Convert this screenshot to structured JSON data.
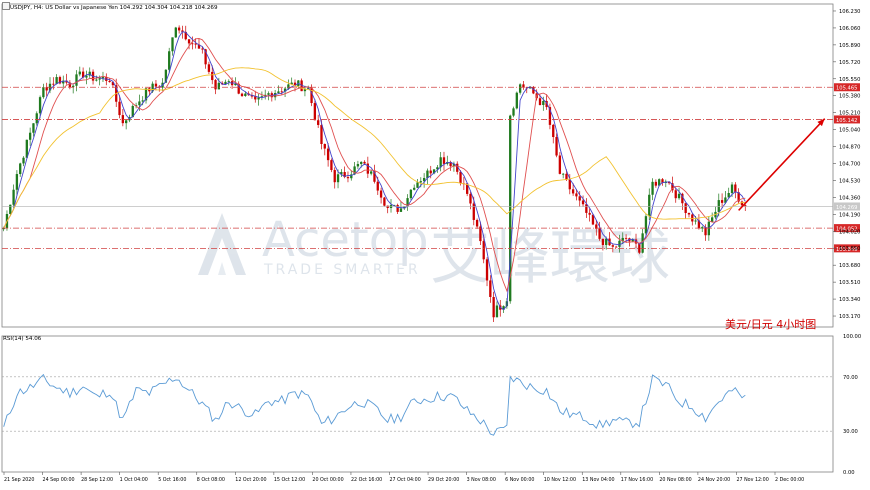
{
  "header": {
    "symbol_line": "USDJPY, H4: US Dollar vs Japanese Yen  104.292 104.304 104.218 104.269",
    "chart_caption": "美元/日元  4小时图",
    "rsi_label": "RSI(14) 54.06"
  },
  "watermark": {
    "brand": "Acetop",
    "tagline": "TRADE SMARTER",
    "chinese": "艾峰環球"
  },
  "colors": {
    "bull": "#1f7a1f",
    "bear": "#cc0000",
    "ma_fast": "#4444cc",
    "ma_mid": "#e05050",
    "ma_slow": "#f2c230",
    "level_line": "#d04040",
    "arrow": "#dd0000",
    "rsi_line": "#5b9bd5",
    "grid": "#c0c0c0",
    "price_tag": "#d62828"
  },
  "chart_data": [
    {
      "type": "candlestick",
      "title": "USDJPY, H4: US Dollar vs Japanese Yen",
      "ylim": [
        103.06,
        106.3
      ],
      "y_ticks": [
        "106.230",
        "106.060",
        "105.890",
        "105.720",
        "105.550",
        "105.380",
        "105.210",
        "105.040",
        "104.870",
        "104.700",
        "104.530",
        "104.360",
        "104.190",
        "104.020",
        "103.850",
        "103.680",
        "103.510",
        "103.340",
        "103.170"
      ],
      "x_ticks": [
        "21 Sep 2020",
        "24 Sep 00:00",
        "28 Sep 12:00",
        "1 Oct 04:00",
        "5 Oct 16:00",
        "8 Oct 08:00",
        "12 Oct 20:00",
        "15 Oct 12:00",
        "20 Oct 00:00",
        "22 Oct 16:00",
        "27 Oct 04:00",
        "29 Oct 20:00",
        "3 Nov 08:00",
        "6 Nov 00:00",
        "10 Nov 12:00",
        "13 Nov 04:00",
        "17 Nov 16:00",
        "20 Nov 08:00",
        "24 Nov 20:00",
        "27 Nov 12:00",
        "2 Dec 00:00"
      ],
      "price_levels": [
        {
          "value": 105.465,
          "label": "105.465"
        },
        {
          "value": 105.142,
          "label": "105.142"
        },
        {
          "value": 104.052,
          "label": "104.052"
        },
        {
          "value": 103.849,
          "label": "103.849"
        }
      ],
      "current_price": {
        "value": 104.269,
        "label": "104.269"
      },
      "forecast_arrow": {
        "from": {
          "bar": 222,
          "price": 104.23
        },
        "to": {
          "bar": 248,
          "price": 105.15
        }
      },
      "keypoints": [
        [
          0,
          104.05
        ],
        [
          4,
          104.6
        ],
        [
          8,
          105.0
        ],
        [
          12,
          105.45
        ],
        [
          16,
          105.55
        ],
        [
          20,
          105.5
        ],
        [
          24,
          105.6
        ],
        [
          28,
          105.55
        ],
        [
          32,
          105.55
        ],
        [
          36,
          105.1
        ],
        [
          40,
          105.3
        ],
        [
          44,
          105.45
        ],
        [
          48,
          105.5
        ],
        [
          52,
          106.1
        ],
        [
          56,
          105.95
        ],
        [
          60,
          105.8
        ],
        [
          64,
          105.45
        ],
        [
          68,
          105.55
        ],
        [
          72,
          105.4
        ],
        [
          76,
          105.3
        ],
        [
          80,
          105.4
        ],
        [
          84,
          105.45
        ],
        [
          88,
          105.5
        ],
        [
          92,
          105.45
        ],
        [
          96,
          104.9
        ],
        [
          100,
          104.55
        ],
        [
          104,
          104.6
        ],
        [
          108,
          104.7
        ],
        [
          112,
          104.55
        ],
        [
          116,
          104.25
        ],
        [
          120,
          104.25
        ],
        [
          124,
          104.5
        ],
        [
          128,
          104.6
        ],
        [
          132,
          104.75
        ],
        [
          136,
          104.7
        ],
        [
          140,
          104.4
        ],
        [
          144,
          103.9
        ],
        [
          148,
          103.2
        ],
        [
          152,
          103.35
        ],
        [
          153,
          105.2
        ],
        [
          156,
          105.5
        ],
        [
          160,
          105.4
        ],
        [
          164,
          105.25
        ],
        [
          168,
          104.6
        ],
        [
          172,
          104.4
        ],
        [
          176,
          104.2
        ],
        [
          180,
          103.95
        ],
        [
          184,
          103.85
        ],
        [
          188,
          103.95
        ],
        [
          192,
          103.85
        ],
        [
          196,
          104.5
        ],
        [
          200,
          104.55
        ],
        [
          204,
          104.35
        ],
        [
          208,
          104.15
        ],
        [
          212,
          104.0
        ],
        [
          216,
          104.3
        ],
        [
          220,
          104.45
        ],
        [
          224,
          104.27
        ]
      ],
      "future_bars": 26
    },
    {
      "type": "line",
      "title": "RSI(14) 54.06",
      "ylim": [
        0,
        100
      ],
      "y_ticks": [
        "100.00",
        "70.00",
        "30.00",
        "0.00"
      ],
      "reference_levels": [
        70,
        30
      ],
      "keypoints": [
        [
          0,
          32
        ],
        [
          4,
          58
        ],
        [
          8,
          62
        ],
        [
          12,
          68
        ],
        [
          16,
          62
        ],
        [
          20,
          58
        ],
        [
          24,
          63
        ],
        [
          28,
          55
        ],
        [
          32,
          60
        ],
        [
          36,
          38
        ],
        [
          40,
          60
        ],
        [
          44,
          58
        ],
        [
          48,
          64
        ],
        [
          52,
          70
        ],
        [
          56,
          60
        ],
        [
          60,
          50
        ],
        [
          64,
          38
        ],
        [
          68,
          52
        ],
        [
          72,
          46
        ],
        [
          76,
          42
        ],
        [
          80,
          52
        ],
        [
          84,
          52
        ],
        [
          88,
          58
        ],
        [
          92,
          56
        ],
        [
          96,
          35
        ],
        [
          100,
          40
        ],
        [
          104,
          48
        ],
        [
          108,
          52
        ],
        [
          112,
          47
        ],
        [
          116,
          38
        ],
        [
          120,
          41
        ],
        [
          124,
          52
        ],
        [
          128,
          54
        ],
        [
          132,
          56
        ],
        [
          136,
          55
        ],
        [
          140,
          45
        ],
        [
          144,
          38
        ],
        [
          148,
          28
        ],
        [
          152,
          32
        ],
        [
          153,
          70
        ],
        [
          156,
          66
        ],
        [
          160,
          62
        ],
        [
          164,
          60
        ],
        [
          168,
          45
        ],
        [
          172,
          42
        ],
        [
          176,
          40
        ],
        [
          180,
          34
        ],
        [
          184,
          38
        ],
        [
          188,
          36
        ],
        [
          192,
          37
        ],
        [
          196,
          68
        ],
        [
          200,
          64
        ],
        [
          204,
          52
        ],
        [
          208,
          48
        ],
        [
          212,
          40
        ],
        [
          216,
          52
        ],
        [
          220,
          60
        ],
        [
          224,
          54
        ]
      ]
    }
  ]
}
